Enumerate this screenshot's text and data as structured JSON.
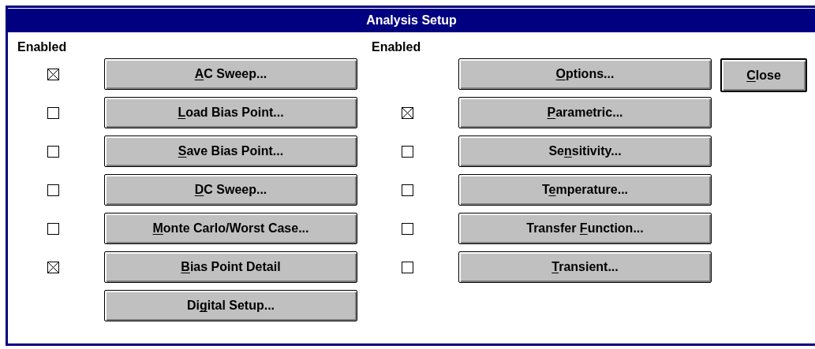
{
  "window": {
    "title": "Analysis Setup"
  },
  "columns": [
    {
      "header": "Enabled",
      "items": [
        {
          "kind": "checkable",
          "checked": true,
          "label": [
            {
              "text": "A",
              "underlined": true
            },
            {
              "text": "C Sweep...",
              "underlined": false
            }
          ]
        },
        {
          "kind": "checkable",
          "checked": false,
          "label": [
            {
              "text": "L",
              "underlined": true
            },
            {
              "text": "oad Bias Point...",
              "underlined": false
            }
          ]
        },
        {
          "kind": "checkable",
          "checked": false,
          "label": [
            {
              "text": "S",
              "underlined": true
            },
            {
              "text": "ave Bias Point...",
              "underlined": false
            }
          ]
        },
        {
          "kind": "checkable",
          "checked": false,
          "label": [
            {
              "text": "D",
              "underlined": true
            },
            {
              "text": "C Sweep...",
              "underlined": false
            }
          ]
        },
        {
          "kind": "checkable",
          "checked": false,
          "label": [
            {
              "text": "M",
              "underlined": true
            },
            {
              "text": "onte Carlo/Worst Case...",
              "underlined": false
            }
          ]
        },
        {
          "kind": "checkable",
          "checked": true,
          "label": [
            {
              "text": "B",
              "underlined": true
            },
            {
              "text": "ias Point Detail",
              "underlined": false
            }
          ]
        },
        {
          "kind": "plain",
          "label": [
            {
              "text": "Di",
              "underlined": false
            },
            {
              "text": "g",
              "underlined": true
            },
            {
              "text": "ital Setup...",
              "underlined": false
            }
          ]
        }
      ]
    },
    {
      "header": "Enabled",
      "items": [
        {
          "kind": "plain",
          "label": [
            {
              "text": "O",
              "underlined": true
            },
            {
              "text": "ptions...",
              "underlined": false
            }
          ]
        },
        {
          "kind": "checkable",
          "checked": true,
          "label": [
            {
              "text": "P",
              "underlined": true
            },
            {
              "text": "arametric...",
              "underlined": false
            }
          ]
        },
        {
          "kind": "checkable",
          "checked": false,
          "label": [
            {
              "text": "Se",
              "underlined": false
            },
            {
              "text": "n",
              "underlined": true
            },
            {
              "text": "sitivity...",
              "underlined": false
            }
          ]
        },
        {
          "kind": "checkable",
          "checked": false,
          "label": [
            {
              "text": "T",
              "underlined": false
            },
            {
              "text": "e",
              "underlined": true
            },
            {
              "text": "mperature...",
              "underlined": false
            }
          ]
        },
        {
          "kind": "checkable",
          "checked": false,
          "label": [
            {
              "text": "Transfer ",
              "underlined": false
            },
            {
              "text": "F",
              "underlined": true
            },
            {
              "text": "unction...",
              "underlined": false
            }
          ]
        },
        {
          "kind": "checkable",
          "checked": false,
          "label": [
            {
              "text": "T",
              "underlined": true
            },
            {
              "text": "ransient...",
              "underlined": false
            }
          ]
        }
      ]
    }
  ],
  "close_button": {
    "label": [
      {
        "text": "C",
        "underlined": true
      },
      {
        "text": "lose",
        "underlined": false
      }
    ]
  }
}
